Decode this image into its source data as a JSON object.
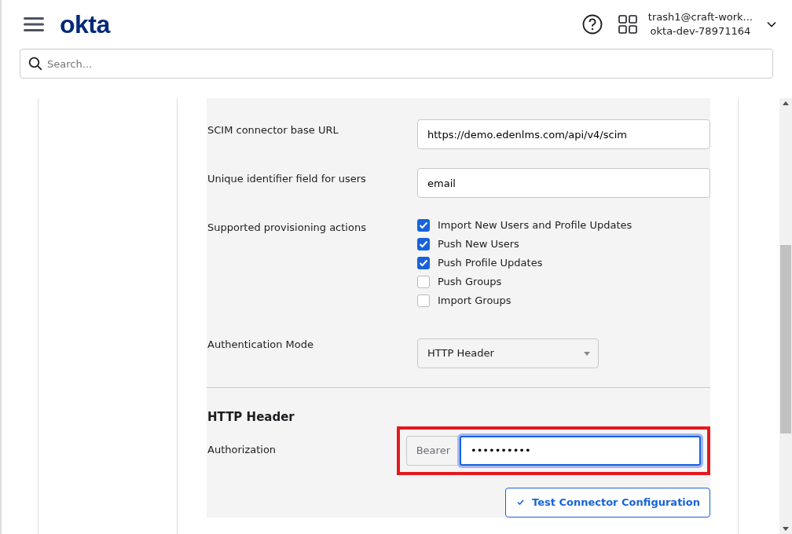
{
  "header": {
    "logo": "okta",
    "user": {
      "email": "trash1@craft-work...",
      "org": "okta-dev-78971164"
    }
  },
  "search": {
    "placeholder": "Search..."
  },
  "form": {
    "fields": [
      {
        "kind": "text",
        "label": "SCIM connector base URL",
        "value": "https://demo.edenlms.com/api/v4/scim"
      },
      {
        "kind": "text",
        "label": "Unique identifier field for users",
        "value": "email"
      },
      {
        "kind": "checkboxes",
        "label": "Supported provisioning actions",
        "options": [
          {
            "label": "Import New Users and Profile Updates",
            "checked": true
          },
          {
            "label": "Push New Users",
            "checked": true
          },
          {
            "label": "Push Profile Updates",
            "checked": true
          },
          {
            "label": "Push Groups",
            "checked": false
          },
          {
            "label": "Import Groups",
            "checked": false
          }
        ]
      },
      {
        "kind": "select",
        "label": "Authentication Mode",
        "value": "HTTP Header"
      }
    ],
    "section_title": "HTTP Header",
    "authorization": {
      "label": "Authorization",
      "prefix": "Bearer",
      "value": "••••••••••",
      "highlighted": true
    },
    "test_button": "Test Connector Configuration"
  }
}
